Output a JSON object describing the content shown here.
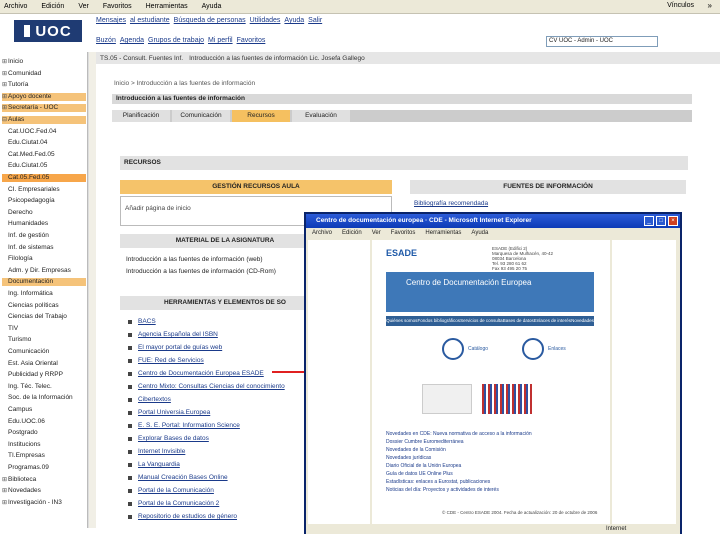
{
  "browser_menu": {
    "items": [
      "Archivo",
      "Edición",
      "Ver",
      "Favoritos",
      "Herramientas",
      "Ayuda"
    ],
    "links": "Vínculos"
  },
  "logo": "UOC",
  "top_nav": [
    "Mensajes",
    "al estudiante",
    "Búsqueda de personas",
    "Utilidades",
    "Ayuda",
    "Salir"
  ],
  "sub_nav": [
    "Buzón",
    "Agenda",
    "Grupos de trabajo",
    "Mi perfil",
    "Favoritos"
  ],
  "user_select": "CV UOC - Admin - UOC",
  "tab_row": [
    "TS.05 - Consult. Fuentes Inf.",
    "Introducción a las fuentes de información Lic. Josefa Gallego"
  ],
  "breadcrumb": "Inicio > Introducción a las fuentes de información",
  "subtitle": "Introducción a las fuentes de información",
  "section_tabs": [
    "Planificación",
    "Comunicación",
    "Recursos",
    "Evaluación"
  ],
  "sidebar": [
    {
      "label": "Inicio",
      "mk": "⊞"
    },
    {
      "label": "Comunidad",
      "mk": "⊞"
    },
    {
      "label": "Tutoría",
      "mk": "⊞"
    },
    {
      "label": "Apoyo docente",
      "mk": "⊞",
      "style": "orange"
    },
    {
      "label": "Secretaría - UOC",
      "mk": "⊞",
      "style": "orange"
    },
    {
      "label": "Aulas",
      "mk": "⊟",
      "style": "orange"
    },
    {
      "label": "Cat.UOC.Fed.04",
      "mk": ""
    },
    {
      "label": "Edu.Ciutat.04",
      "mk": ""
    },
    {
      "label": "Cat.Med.Fed.05",
      "mk": ""
    },
    {
      "label": "Edu.Ciutat.05",
      "mk": ""
    },
    {
      "label": "Cat.05.Fed.05",
      "mk": "",
      "style": "hl"
    },
    {
      "label": "CI. Empresariales",
      "mk": ""
    },
    {
      "label": "Psicopedagogía",
      "mk": ""
    },
    {
      "label": "Derecho",
      "mk": ""
    },
    {
      "label": "Humanidades",
      "mk": ""
    },
    {
      "label": "Inf. de gestión",
      "mk": ""
    },
    {
      "label": "Inf. de sistemas",
      "mk": ""
    },
    {
      "label": "Filología",
      "mk": ""
    },
    {
      "label": "Adm. y Dir. Empresas",
      "mk": ""
    },
    {
      "label": "Documentación",
      "mk": "",
      "style": "orange"
    },
    {
      "label": "Ing. Informática",
      "mk": ""
    },
    {
      "label": "Ciencias políticas",
      "mk": ""
    },
    {
      "label": "Ciencias del Trabajo",
      "mk": ""
    },
    {
      "label": "TIV",
      "mk": ""
    },
    {
      "label": "Turismo",
      "mk": ""
    },
    {
      "label": "Comunicación",
      "mk": ""
    },
    {
      "label": "Est. Asia Oriental",
      "mk": ""
    },
    {
      "label": "Publicidad y RRPP",
      "mk": ""
    },
    {
      "label": "Ing. Téc. Telec.",
      "mk": ""
    },
    {
      "label": "Soc. de la Información",
      "mk": ""
    },
    {
      "label": "Campus",
      "mk": ""
    },
    {
      "label": "Edu.UOC.06",
      "mk": ""
    },
    {
      "label": "Postgrado",
      "mk": ""
    },
    {
      "label": "Institucions",
      "mk": ""
    },
    {
      "label": "TI.Empresas",
      "mk": ""
    },
    {
      "label": "Programas.09",
      "mk": ""
    },
    {
      "label": "Biblioteca",
      "mk": "⊞"
    },
    {
      "label": "Novedades",
      "mk": "⊞"
    },
    {
      "label": "Investigación - IN3",
      "mk": "⊞"
    }
  ],
  "recursos_title": "RECURSOS",
  "gestion_title": "GESTIÓN RECURSOS AULA",
  "gestion_text": "Añadir página de inicio",
  "fuentes_title": "FUENTES DE INFORMACIÓN",
  "fuentes_link": "Bibliografía recomendada",
  "material_title": "MATERIAL DE LA ASIGNATURA",
  "material_items": [
    "Introducción a las fuentes de información (web)",
    "Introducción a las fuentes de información (CD-Rom)"
  ],
  "herramientas_title": "HERRAMIENTAS Y ELEMENTOS DE SO",
  "herramientas_items": [
    "BACS",
    "Agencia Española del ISBN",
    "El mayor portal de guías web",
    "FUE: Red de Servicios",
    "Centro de Documentación Europea ESADE",
    "Centro Mixto: Consultas Ciencias del conocimiento",
    "Cibertextos",
    "Portal Universia.Europea",
    "E. S. E. Portal: Information Science",
    "Explorar Bases de datos",
    "Internet Invisible",
    "La Vanguardia",
    "Manual Creación Bases Online",
    "Portal de la Comunicación",
    "Portal de la Comunicación 2",
    "Repositorio de estudios de género"
  ],
  "ie_window": {
    "title": "Centro de documentación europea · CDE - Microsoft Internet Explorer",
    "menu": [
      "Archivo",
      "Edición",
      "Ver",
      "Favoritos",
      "Herramientas",
      "Ayuda"
    ],
    "esade": "ESADE",
    "address": [
      "ESADE (Edifici 2)",
      "Marquesa de Mulhacén, 40-42",
      "08034 Barcelona",
      "Tel. 93 280 61 62",
      "Fax 93 495 20 75"
    ],
    "banner1": "Centro de Documentación Europea",
    "nav": [
      "Quiénes somos",
      "Fondos bibliográficos",
      "Servicios de consulta",
      "Bases de datos",
      "Enlaces de interés",
      "Novedades"
    ],
    "circles": [
      "Catálogo",
      "Enlaces"
    ],
    "news": [
      "Novedades en CDE: Nueva normativa de acceso a la información",
      "Dossier Cumbre Euromediterránea",
      "Novedades de la Comisión",
      "Novedades jurídicas",
      "Diario Oficial de la Unión Europea",
      "Guía de datos UE Online Plus",
      "Estadísticas: enlaces a Eurostat, publicaciones",
      "Noticias del día: Proyectos y actividades de interés"
    ],
    "footer": "© CDE - Centro ESADE 2004. Fecha de actualización: 20 de octubre de 2006",
    "status": "Internet"
  },
  "colors": {
    "uoc_blue": "#1f3b73",
    "tab_orange": "#f5c060",
    "arrow": "#e02020"
  }
}
